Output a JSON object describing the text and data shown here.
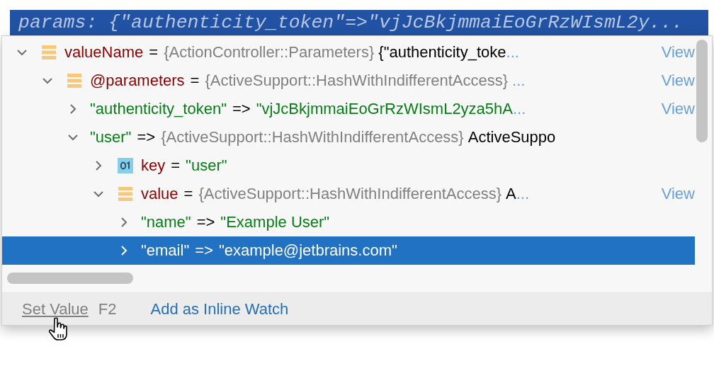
{
  "header": {
    "text": "params: {\"authenticity_token\"=>\"vjJcBkjmmaiEoGrRzWIsmL2y..."
  },
  "tree": [
    {
      "kind": "object",
      "name": "valueName",
      "operator": "=",
      "type": "{ActionController::Parameters}",
      "value": "{\"authenticity_toke",
      "ellipsis": "...",
      "link": "View",
      "expanded": true,
      "selected": false,
      "children": [
        {
          "kind": "object",
          "name": "@parameters",
          "operator": "=",
          "type": "{ActiveSupport::HashWithIndifferentAccess}",
          "ellipsis": "...",
          "link": "View",
          "expanded": true,
          "selected": false,
          "children": [
            {
              "kind": "entry",
              "name": "\"authenticity_token\"",
              "operator": "=>",
              "string_value": "\"vjJcBkjmmaiEoGrRzWIsmL2yza5hA",
              "ellipsis": "...",
              "link": "View",
              "expanded": false,
              "selected": false
            },
            {
              "kind": "entry",
              "name": "\"user\"",
              "operator": "=>",
              "type": "{ActiveSupport::HashWithIndifferentAccess}",
              "value": "ActiveSuppo",
              "expanded": true,
              "selected": false,
              "children": [
                {
                  "kind": "primitive",
                  "name": "key",
                  "operator": "=",
                  "string_value": "\"user\"",
                  "expanded": false,
                  "selected": false
                },
                {
                  "kind": "object",
                  "name": "value",
                  "operator": "=",
                  "type": "{ActiveSupport::HashWithIndifferentAccess}",
                  "value": "A",
                  "ellipsis": "...",
                  "link": "View",
                  "expanded": true,
                  "selected": false,
                  "children": [
                    {
                      "kind": "entry",
                      "name": "\"name\"",
                      "operator": "=>",
                      "string_value": "\"Example User\"",
                      "expanded": false,
                      "selected": false
                    },
                    {
                      "kind": "entry",
                      "name": "\"email\"",
                      "operator": "=>",
                      "string_value": "\"example@jetbrains.com\"",
                      "expanded": false,
                      "selected": true
                    }
                  ]
                }
              ]
            }
          ]
        }
      ]
    }
  ],
  "footer": {
    "set_value": "Set Value",
    "shortcut": "F2",
    "inline_watch": "Add as Inline Watch"
  }
}
